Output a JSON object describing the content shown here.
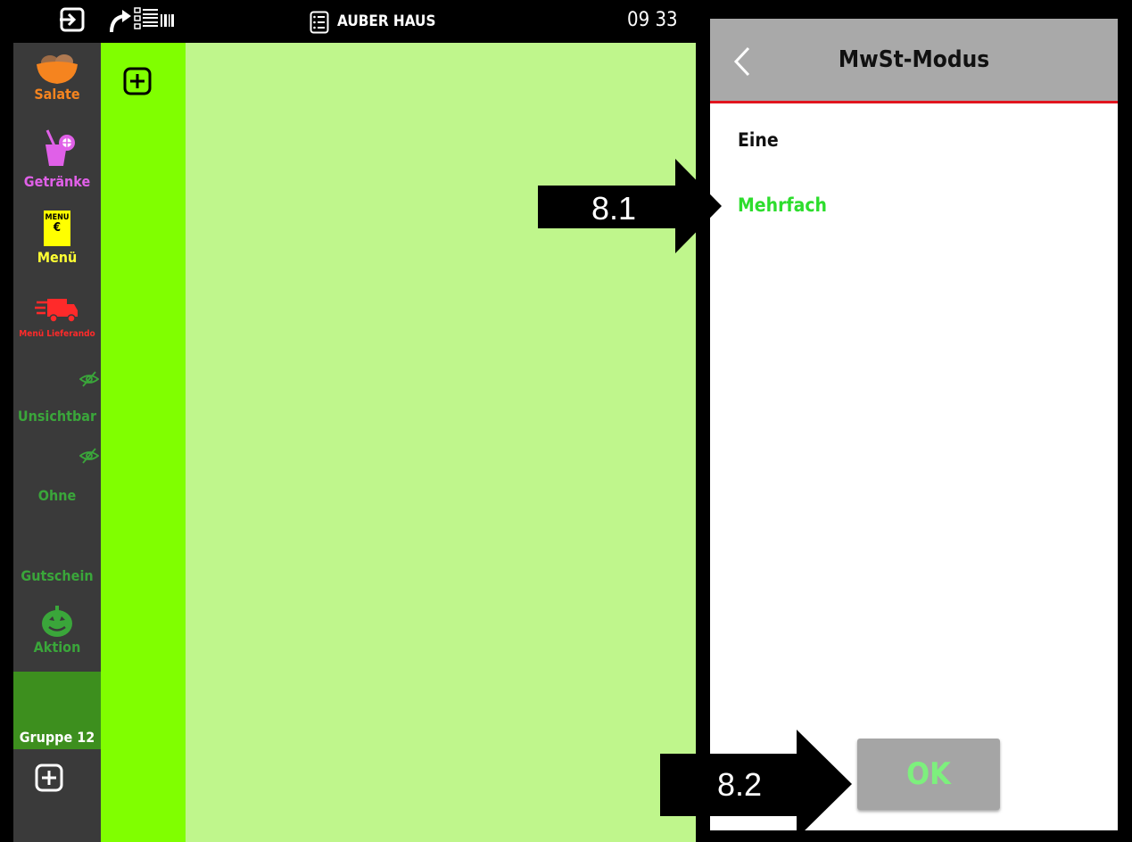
{
  "topbar": {
    "mode_label": "AUBER HAUS",
    "time": "09 33"
  },
  "sidebar": {
    "categories": [
      {
        "label": "Salate",
        "color": "#f5841f",
        "icon": "salad-bowl-icon"
      },
      {
        "label": "Getränke",
        "color": "#e060e8",
        "icon": "drink-glass-icon"
      },
      {
        "label": "Menü",
        "color": "#ffff33",
        "icon": "menu-card-icon",
        "icon_text": "MENU €"
      },
      {
        "label": "Menü Lieferando",
        "color": "#ff2a2a",
        "icon": "delivery-truck-icon"
      },
      {
        "label": "Unsichtbar",
        "color": "#3aa63a",
        "icon": "hidden-eye-icon"
      },
      {
        "label": "Ohne",
        "color": "#3aa63a",
        "icon": "hidden-eye-icon"
      },
      {
        "label": "Gutschein",
        "color": "#3aa63a"
      },
      {
        "label": "Aktion",
        "color": "#3aa63a",
        "icon": "pumpkin-icon"
      },
      {
        "label": "Gruppe 12",
        "color": "#ffffff",
        "selected_bg": "#3d8f1e"
      }
    ]
  },
  "dialog": {
    "title": "MwSt-Modus",
    "options": [
      {
        "label": "Eine",
        "selected": false
      },
      {
        "label": "Mehrfach",
        "selected": true
      }
    ],
    "ok_label": "OK"
  },
  "annotations": {
    "arrow1": "8.1",
    "arrow2": "8.2"
  },
  "colors": {
    "accent_green": "#2ddd2d",
    "header_red": "#e1141e",
    "group_bg": "#80ff00",
    "content_bg": "#bff68c"
  }
}
